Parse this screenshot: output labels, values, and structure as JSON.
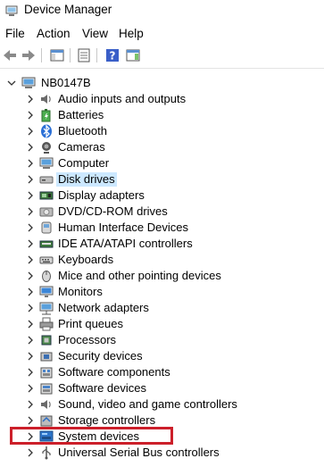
{
  "window": {
    "title": "Device Manager"
  },
  "menu": [
    "File",
    "Action",
    "View",
    "Help"
  ],
  "tree": {
    "root": "NB0147B",
    "items": [
      {
        "label": "Audio inputs and outputs",
        "icon": "speaker-icon"
      },
      {
        "label": "Batteries",
        "icon": "battery-icon"
      },
      {
        "label": "Bluetooth",
        "icon": "bluetooth-icon"
      },
      {
        "label": "Cameras",
        "icon": "camera-icon"
      },
      {
        "label": "Computer",
        "icon": "computer-icon"
      },
      {
        "label": "Disk drives",
        "icon": "disk-drive-icon"
      },
      {
        "label": "Display adapters",
        "icon": "display-adapter-icon"
      },
      {
        "label": "DVD/CD-ROM drives",
        "icon": "dvd-drive-icon"
      },
      {
        "label": "Human Interface Devices",
        "icon": "hid-icon"
      },
      {
        "label": "IDE ATA/ATAPI controllers",
        "icon": "ide-controller-icon"
      },
      {
        "label": "Keyboards",
        "icon": "keyboard-icon"
      },
      {
        "label": "Mice and other pointing devices",
        "icon": "mouse-icon"
      },
      {
        "label": "Monitors",
        "icon": "monitor-icon"
      },
      {
        "label": "Network adapters",
        "icon": "network-adapter-icon"
      },
      {
        "label": "Print queues",
        "icon": "printer-icon"
      },
      {
        "label": "Processors",
        "icon": "processor-icon"
      },
      {
        "label": "Security devices",
        "icon": "security-device-icon"
      },
      {
        "label": "Software components",
        "icon": "software-component-icon"
      },
      {
        "label": "Software devices",
        "icon": "software-device-icon"
      },
      {
        "label": "Sound, video and game controllers",
        "icon": "sound-controller-icon"
      },
      {
        "label": "Storage controllers",
        "icon": "storage-controller-icon"
      },
      {
        "label": "System devices",
        "icon": "system-devices-icon"
      },
      {
        "label": "Universal Serial Bus controllers",
        "icon": "usb-icon"
      }
    ],
    "selected_index": 5,
    "highlighted_index": 21
  },
  "colors": {
    "selection": "#cce8ff",
    "highlight_box": "#cc1f2a",
    "help_button": "#3a5fc8"
  }
}
